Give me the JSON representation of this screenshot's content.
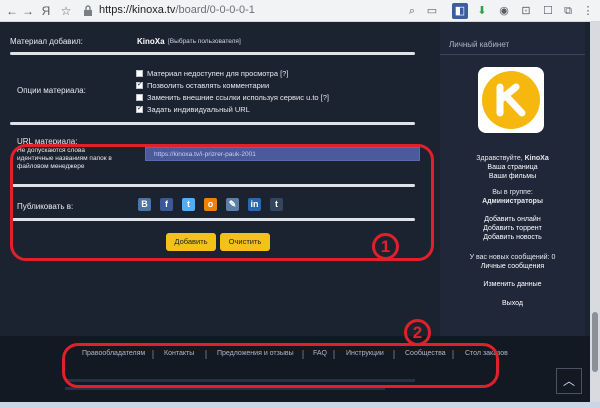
{
  "browser": {
    "url_domain": "https://kinoxa.tv",
    "url_path": "/board/0-0-0-0-1"
  },
  "form": {
    "added_by_label": "Материал добавил:",
    "added_by_value": "KinoXa",
    "choose_user": "[Выбрать пользователя]",
    "options_label": "Опции материала:",
    "options": [
      {
        "label": "Материал недоступен для просмотра [?]",
        "checked": false
      },
      {
        "label": "Позволить оставлять комментарии",
        "checked": true
      },
      {
        "label": "Заменить внешние ссылки используя сервис u.to [?]",
        "checked": false
      },
      {
        "label": "Задать индивидуальный URL",
        "checked": true
      }
    ],
    "url_label": "URL материала:",
    "url_hint_1": "Не допускаются слова",
    "url_hint_2": "идентичные названиям папок в",
    "url_hint_3": "файловом менеджере",
    "url_value": "https://kinoxa.tv/i-prizrer-pauk-2001",
    "publish_label": "Публиковать в:",
    "add_button": "Добавить",
    "clear_button": "Очистить"
  },
  "sidebar": {
    "title": "Личный кабинет",
    "greeting_prefix": "Здравствуйте,",
    "username": "KinoXa",
    "my_page": "Ваша страница",
    "my_films": "Ваши фильмы",
    "group_label": "Вы в группе:",
    "group_name": "Администраторы",
    "add_online": "Добавить онлайн",
    "add_torrent": "Добавить торрент",
    "add_news": "Добавить новость",
    "messages_label": "У вас новых сообщений: 0",
    "personal_messages": "Личные сообщения",
    "edit_data": "Изменить данные",
    "logout": "Выход"
  },
  "footer": {
    "links": [
      "Правообладателям",
      "Контакты",
      "Предложения и отзывы",
      "FAQ",
      "Инструкции",
      "Сообщества",
      "Стол заказов"
    ]
  },
  "annotations": {
    "one": "1",
    "two": "2"
  },
  "colors": {
    "accent_yellow": "#f2c21b",
    "annotation_red": "#e0202a",
    "background": "#1b2230"
  }
}
